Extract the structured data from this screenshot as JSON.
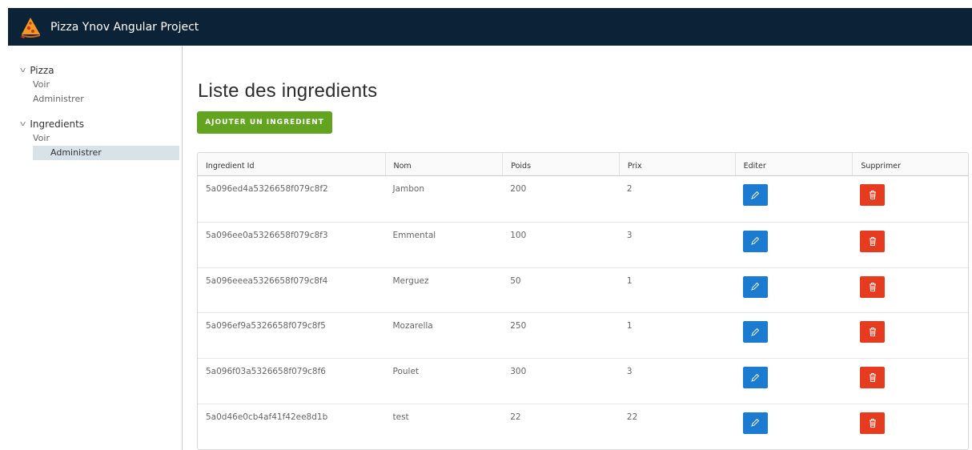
{
  "header": {
    "title": "Pizza Ynov Angular Project",
    "logo_icon": "pizza-icon"
  },
  "sidebar": {
    "groups": [
      {
        "label": "Pizza",
        "items": [
          {
            "label": "Voir"
          },
          {
            "label": "Administrer"
          }
        ]
      },
      {
        "label": "Ingredients",
        "items": [
          {
            "label": "Voir"
          },
          {
            "label": "Administrer",
            "active": true
          }
        ]
      }
    ]
  },
  "main": {
    "title": "Liste des ingredients",
    "add_button": "AJOUTER UN INGREDIENT"
  },
  "table": {
    "columns": [
      "Ingredient Id",
      "Nom",
      "Poids",
      "Prix",
      "Editer",
      "Supprimer"
    ],
    "rows": [
      {
        "id": "5a096ed4a5326658f079c8f2",
        "nom": "Jambon",
        "poids": "200",
        "prix": "2"
      },
      {
        "id": "5a096ee0a5326658f079c8f3",
        "nom": "Emmental",
        "poids": "100",
        "prix": "3"
      },
      {
        "id": "5a096eeea5326658f079c8f4",
        "nom": "Merguez",
        "poids": "50",
        "prix": "1"
      },
      {
        "id": "5a096ef9a5326658f079c8f5",
        "nom": "Mozarella",
        "poids": "250",
        "prix": "1"
      },
      {
        "id": "5a096f03a5326658f079c8f6",
        "nom": "Poulet",
        "poids": "300",
        "prix": "3"
      },
      {
        "id": "5a0d46e0cb4af41f42ee8d1b",
        "nom": "test",
        "poids": "22",
        "prix": "22"
      }
    ]
  },
  "colors": {
    "header_bg": "#0c2236",
    "add_button": "#62a420",
    "edit_button": "#1a7bd0",
    "delete_button": "#e63b1f",
    "active_nav": "#d8e3e9"
  }
}
